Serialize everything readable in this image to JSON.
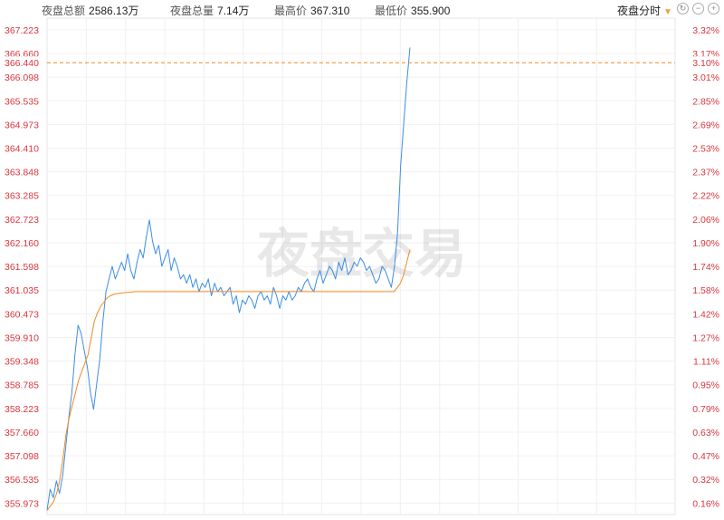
{
  "header": {
    "total_amount_label": "夜盘总额",
    "total_amount_value": "2586.13万",
    "total_volume_label": "夜盘总量",
    "total_volume_value": "7.14万",
    "high_label": "最高价",
    "high_value": "367.310",
    "low_label": "最低价",
    "low_value": "355.900",
    "mode_label": "夜盘分时",
    "controls": [
      "refresh-icon",
      "zoom-out-icon",
      "zoom-in-icon"
    ]
  },
  "watermark": "夜盘交易",
  "colors": {
    "price": "#3a8ee6",
    "average": "#f08a24",
    "axis_text": "#d9363e",
    "current": "#f08a24"
  },
  "chart_data": {
    "type": "line",
    "ylim": [
      355.7,
      367.5
    ],
    "y_ticks": [
      "367.223",
      "366.660",
      "366.098",
      "365.535",
      "364.973",
      "364.410",
      "363.848",
      "363.285",
      "362.723",
      "362.160",
      "361.598",
      "361.035",
      "360.473",
      "359.910",
      "359.348",
      "358.785",
      "358.223",
      "357.660",
      "357.098",
      "356.535",
      "355.973"
    ],
    "y_tick_values": [
      367.223,
      366.66,
      366.098,
      365.535,
      364.973,
      364.41,
      363.848,
      363.285,
      362.723,
      362.16,
      361.598,
      361.035,
      360.473,
      359.91,
      359.348,
      358.785,
      358.223,
      357.66,
      357.098,
      356.535,
      355.973
    ],
    "right_ticks": [
      "3.32%",
      "3.17%",
      "3.01%",
      "2.85%",
      "2.69%",
      "2.53%",
      "2.37%",
      "2.22%",
      "2.06%",
      "1.90%",
      "1.74%",
      "1.58%",
      "1.42%",
      "1.27%",
      "1.11%",
      "0.95%",
      "0.79%",
      "0.63%",
      "0.47%",
      "0.32%",
      "0.16%"
    ],
    "current_price": "366.440",
    "current_change": "3.10%",
    "grid": true,
    "series": [
      {
        "values": [
          355.8,
          356.3,
          356.1,
          356.5,
          356.2,
          356.6,
          357.3,
          358.0,
          358.6,
          359.5,
          360.2,
          360.0,
          359.6,
          359.2,
          358.6,
          358.2,
          358.8,
          359.4,
          360.3,
          361.0,
          361.3,
          361.6,
          361.3,
          361.5,
          361.7,
          361.5,
          361.9,
          361.5,
          361.3,
          361.7,
          362.0,
          361.8,
          362.3,
          362.7,
          362.2,
          361.9,
          362.1,
          361.6,
          361.8,
          362.0,
          361.5,
          361.8,
          361.6,
          361.3,
          361.4,
          361.2,
          361.4,
          361.1,
          361.3,
          361.0,
          361.2,
          361.1,
          361.3,
          360.9,
          361.2,
          361.0,
          361.1,
          360.9,
          361.0,
          361.1,
          360.7,
          360.9,
          360.5,
          360.8,
          360.7,
          360.9,
          360.8,
          360.6,
          360.9,
          361.0,
          360.8,
          360.9,
          360.7,
          361.1,
          360.9,
          360.6,
          360.9,
          360.8,
          361.0,
          360.8,
          360.9,
          361.1,
          361.0,
          361.2,
          361.3,
          361.1,
          361.0,
          361.3,
          361.5,
          361.2,
          361.4,
          361.6,
          361.5,
          361.3,
          361.7,
          361.5,
          361.8,
          361.4,
          361.5,
          361.7,
          361.6,
          361.8,
          361.7,
          361.5,
          361.6,
          361.4,
          361.2,
          361.3,
          361.6,
          361.5,
          361.3,
          361.1,
          361.6,
          362.4,
          364.0,
          365.0,
          366.0,
          366.8
        ]
      },
      {
        "values": [
          355.8,
          355.9,
          356.0,
          356.2,
          356.5,
          357.0,
          357.6,
          358.0,
          358.3,
          358.6,
          358.9,
          359.1,
          359.3,
          359.5,
          359.9,
          360.3,
          360.5,
          360.65,
          360.75,
          360.85,
          360.9,
          360.93,
          360.95,
          360.96,
          360.97,
          360.98,
          360.985,
          360.99,
          361.0,
          361.0,
          361.0,
          361.0,
          361.0,
          361.0,
          361.0,
          361.0,
          361.0,
          361.0,
          361.0,
          361.0,
          361.0,
          361.0,
          361.0,
          361.0,
          361.0,
          361.0,
          361.0,
          361.0,
          361.0,
          361.0,
          361.0,
          361.0,
          361.0,
          361.0,
          361.0,
          361.0,
          361.0,
          361.0,
          361.0,
          361.0,
          361.0,
          361.0,
          361.0,
          361.0,
          361.0,
          361.0,
          361.0,
          361.0,
          361.0,
          361.0,
          361.0,
          361.0,
          361.0,
          361.0,
          361.0,
          361.0,
          361.0,
          361.0,
          361.0,
          361.0,
          361.0,
          361.0,
          361.0,
          361.0,
          361.0,
          361.0,
          361.0,
          361.0,
          361.0,
          361.0,
          361.0,
          361.0,
          361.0,
          361.0,
          361.0,
          361.0,
          361.0,
          361.0,
          361.0,
          361.0,
          361.0,
          361.0,
          361.0,
          361.0,
          361.0,
          361.0,
          361.0,
          361.0,
          361.0,
          361.0,
          361.0,
          361.1,
          361.2,
          361.4,
          361.7,
          362.0
        ]
      }
    ]
  }
}
